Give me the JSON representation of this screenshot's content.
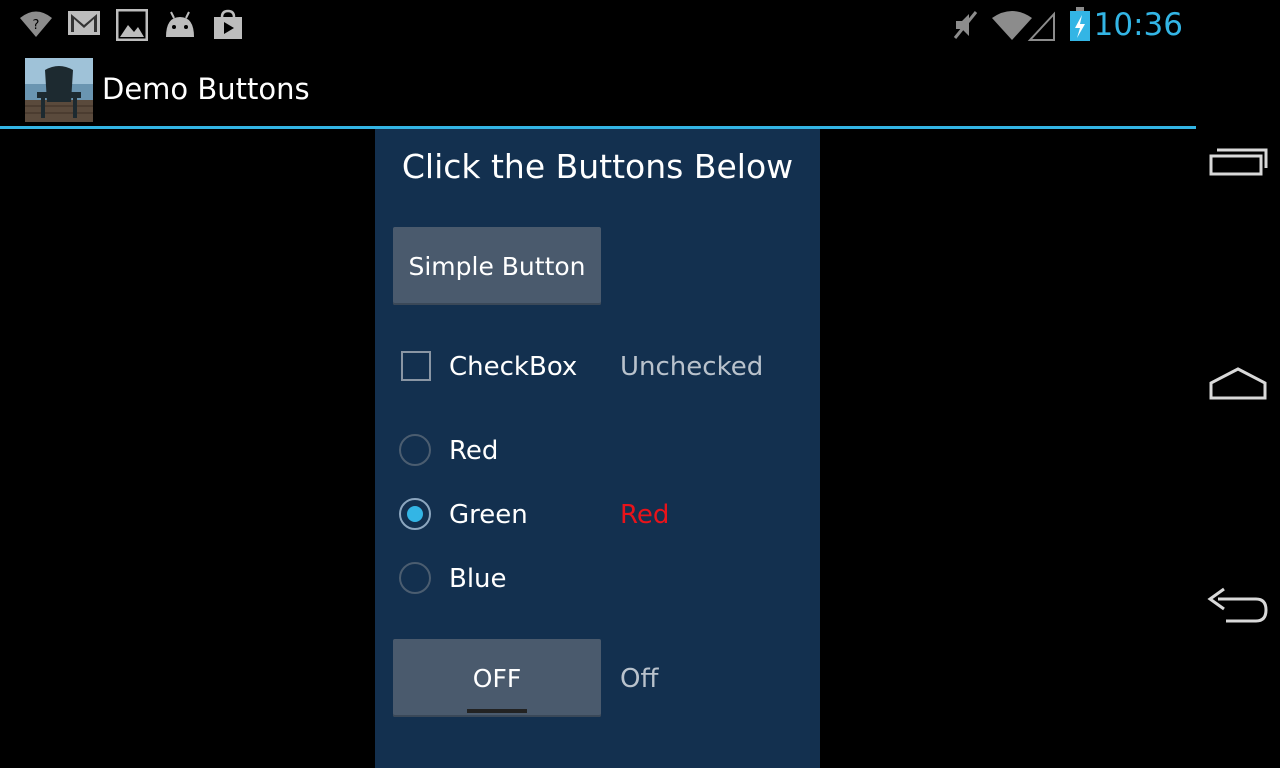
{
  "status_bar": {
    "time": "10:36",
    "icons": [
      "wifi-question-icon",
      "gmail-icon",
      "gallery-icon",
      "android-icon",
      "play-store-icon",
      "mute-icon",
      "signal-icon",
      "battery-charging-icon"
    ]
  },
  "action_bar": {
    "title": "Demo Buttons"
  },
  "main": {
    "heading": "Click the Buttons Below",
    "simple_button_label": "Simple Button",
    "checkbox_label": "CheckBox",
    "checkbox_status": "Unchecked",
    "radio_options": [
      "Red",
      "Green",
      "Blue"
    ],
    "radio_selected": "Green",
    "radio_status": "Red",
    "toggle_label": "OFF",
    "toggle_status": "Off"
  },
  "colors": {
    "accent": "#33b5e5",
    "panel_bg": "#13304f",
    "status_red": "#e8131a"
  },
  "nav_bar": {
    "icons": [
      "recent-apps-icon",
      "home-icon",
      "back-icon"
    ]
  }
}
